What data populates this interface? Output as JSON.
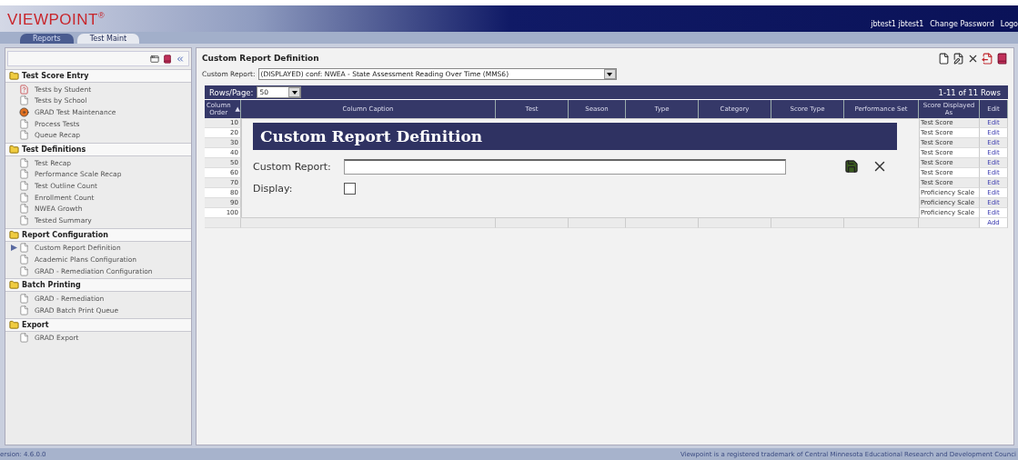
{
  "header": {
    "logo": "VIEWPOINT",
    "logo_mark": "®",
    "user_links": [
      "jbtest1 jbtest1",
      "Change Password",
      "Logo"
    ]
  },
  "tabs": [
    {
      "label": "Reports",
      "selected": false
    },
    {
      "label": "Test Maint",
      "selected": true
    }
  ],
  "sidebar": {
    "sections": [
      {
        "title": "Test Score Entry",
        "items": [
          {
            "label": "Tests by Student",
            "kind": "help",
            "selected": false
          },
          {
            "label": "Tests by School",
            "kind": "page",
            "selected": false
          },
          {
            "label": "GRAD Test Maintenance",
            "kind": "tool",
            "selected": false
          },
          {
            "label": "Process Tests",
            "kind": "page",
            "selected": false
          },
          {
            "label": "Queue Recap",
            "kind": "page",
            "selected": false
          }
        ]
      },
      {
        "title": "Test Definitions",
        "items": [
          {
            "label": "Test Recap",
            "kind": "page",
            "selected": false
          },
          {
            "label": "Performance Scale Recap",
            "kind": "page",
            "selected": false
          },
          {
            "label": "Test Outline Count",
            "kind": "page",
            "selected": false
          },
          {
            "label": "Enrollment Count",
            "kind": "page",
            "selected": false
          },
          {
            "label": "NWEA Growth",
            "kind": "page",
            "selected": false
          },
          {
            "label": "Tested Summary",
            "kind": "page",
            "selected": false
          }
        ]
      },
      {
        "title": "Report Configuration",
        "items": [
          {
            "label": "Custom Report Definition",
            "kind": "page",
            "selected": true
          },
          {
            "label": "Academic Plans Configuration",
            "kind": "page",
            "selected": false
          },
          {
            "label": "GRAD - Remediation Configuration",
            "kind": "page",
            "selected": false
          }
        ]
      },
      {
        "title": "Batch Printing",
        "items": [
          {
            "label": "GRAD - Remediation",
            "kind": "page",
            "selected": false
          },
          {
            "label": "GRAD Batch Print Queue",
            "kind": "page",
            "selected": false
          }
        ]
      },
      {
        "title": "Export",
        "items": [
          {
            "label": "GRAD Export",
            "kind": "page",
            "selected": false
          }
        ]
      }
    ]
  },
  "main": {
    "title": "Custom Report Definition",
    "custom_report": {
      "label": "Custom Report:",
      "value": "(DISPLAYED) conf: NWEA - State Assessment Reading Over Time (MMS6)"
    },
    "table": {
      "rows_per_page": {
        "label": "Rows/Page:",
        "value": "50"
      },
      "range": "1-11 of 11 Rows",
      "columns": [
        {
          "label": "Column Order",
          "sort": "▲"
        },
        {
          "label": "Column Caption"
        },
        {
          "label": "Test"
        },
        {
          "label": "Season"
        },
        {
          "label": "Type"
        },
        {
          "label": "Category"
        },
        {
          "label": "Score Type"
        },
        {
          "label": "Performance Set"
        },
        {
          "label": "Score Displayed As"
        },
        {
          "label": "Edit"
        }
      ],
      "rows": [
        {
          "order": "10",
          "score_displayed_as": "Test Score",
          "action": "Edit"
        },
        {
          "order": "20",
          "score_displayed_as": "Test Score",
          "action": "Edit"
        },
        {
          "order": "30",
          "score_displayed_as": "Test Score",
          "action": "Edit"
        },
        {
          "order": "40",
          "score_displayed_as": "Test Score",
          "action": "Edit"
        },
        {
          "order": "50",
          "score_displayed_as": "Test Score",
          "action": "Edit"
        },
        {
          "order": "60",
          "score_displayed_as": "Test Score",
          "action": "Edit"
        },
        {
          "order": "70",
          "score_displayed_as": "Test Score",
          "action": "Edit"
        },
        {
          "order": "80",
          "score_displayed_as": "Proficiency Scale",
          "action": "Edit"
        },
        {
          "order": "90",
          "score_displayed_as": "Proficiency Scale",
          "action": "Edit"
        },
        {
          "order": "100",
          "score_displayed_as": "Proficiency Scale",
          "action": "Edit"
        }
      ],
      "add_link": "Add"
    },
    "dialog": {
      "title": "Custom Report Definition",
      "fields": [
        {
          "kind": "text",
          "label": "Custom Report:"
        },
        {
          "kind": "checkbox",
          "label": "Display:",
          "checked": false
        }
      ]
    }
  },
  "status_bar": {
    "version": "ersion: 4.6.0.0",
    "trademark": "Viewpoint is a registered trademark of Central Minnesota Educational Research and Development Counci"
  }
}
